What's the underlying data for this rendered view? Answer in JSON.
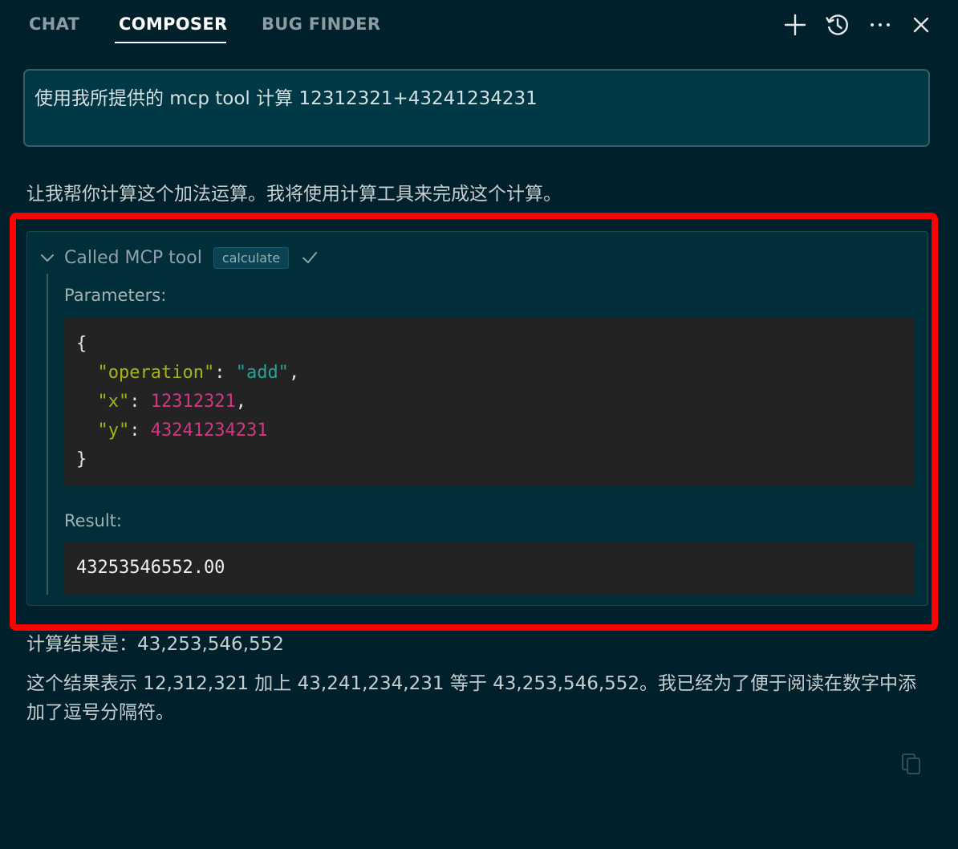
{
  "tabs": [
    {
      "label": "CHAT",
      "active": false
    },
    {
      "label": "COMPOSER",
      "active": true
    },
    {
      "label": "BUG FINDER",
      "active": false
    }
  ],
  "toolbar": {
    "icons": [
      "plus-icon",
      "history-icon",
      "more-icon",
      "close-icon"
    ]
  },
  "prompt": {
    "text": "使用我所提供的 mcp tool 计算 12312321+43241234231"
  },
  "assistant": {
    "intro": "让我帮你计算这个加法运算。我将使用计算工具来完成这个计算。",
    "result_line": "计算结果是：43,253,546,552",
    "explanation": "这个结果表示 12,312,321 加上 43,241,234,231 等于 43,253,546,552。我已经为了便于阅读在数字中添加了逗号分隔符。"
  },
  "tool_call": {
    "title": "Called MCP tool",
    "tool_name": "calculate",
    "status": "success",
    "parameters_label": "Parameters:",
    "parameters": {
      "open": "{",
      "close": "}",
      "entries": [
        {
          "key": "\"operation\"",
          "value": "\"add\"",
          "sep": ",",
          "type": "string"
        },
        {
          "key": "\"x\"",
          "value": "12312321",
          "sep": ",",
          "type": "number"
        },
        {
          "key": "\"y\"",
          "value": "43241234231",
          "sep": "",
          "type": "number"
        }
      ]
    },
    "result_label": "Result:",
    "result_value": "43253546552.00"
  },
  "colors": {
    "background": "#00212b",
    "highlight": "#ff0000",
    "json_key": "#a6b21a",
    "json_string": "#2aa198",
    "json_number": "#d33682"
  }
}
